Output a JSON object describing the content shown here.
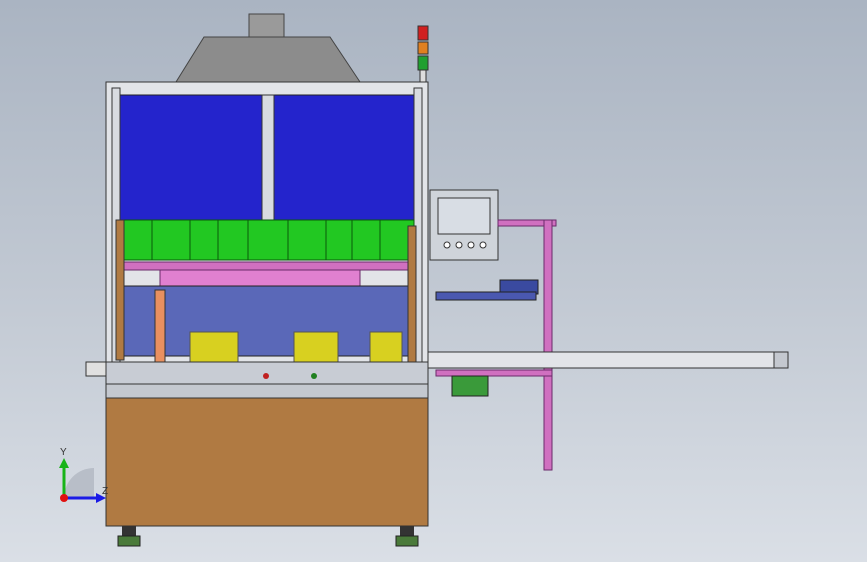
{
  "viewport": {
    "background": "#c3cad4"
  },
  "triad": {
    "y_label": "Y",
    "z_label": "Z",
    "y_color": "#18b418",
    "z_color": "#1a1ae6",
    "origin_color": "#e01010"
  },
  "colors": {
    "frame": "#d8dbe0",
    "window_blue": "#2020d0",
    "green_parts": "#22c822",
    "pink_rails": "#d070c0",
    "cabinet": "#b07a42",
    "hood": "#8a8a8a",
    "hmi": "#cfd4da"
  },
  "stack_light": {
    "colors": [
      "#d02020",
      "#e08020",
      "#20a030"
    ]
  }
}
